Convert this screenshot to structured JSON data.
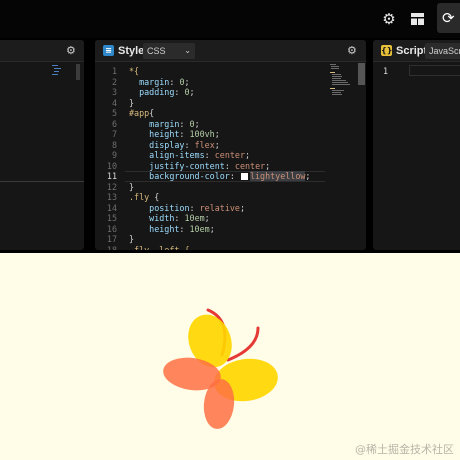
{
  "toolbar": {
    "icons": [
      "gear-icon",
      "layout-icon",
      "run-icon"
    ]
  },
  "css_panel": {
    "title": "Style",
    "badge": "≡",
    "lang": "CSS",
    "lines": [
      [
        [
          "*{",
          "t-sel"
        ]
      ],
      [
        [
          "  margin",
          "t-prop"
        ],
        [
          ": ",
          "t-br"
        ],
        [
          "0",
          "t-num"
        ],
        [
          ";",
          "t-br"
        ]
      ],
      [
        [
          "  padding",
          "t-prop"
        ],
        [
          ": ",
          "t-br"
        ],
        [
          "0",
          "t-num"
        ],
        [
          ";",
          "t-br"
        ]
      ],
      [
        [
          "}",
          "t-br"
        ]
      ],
      [
        [
          "#app",
          "t-sel"
        ],
        [
          "{",
          "t-br"
        ]
      ],
      [
        [
          "    margin",
          "t-prop"
        ],
        [
          ": ",
          "t-br"
        ],
        [
          "0",
          "t-num"
        ],
        [
          ";",
          "t-br"
        ]
      ],
      [
        [
          "    height",
          "t-prop"
        ],
        [
          ": ",
          "t-br"
        ],
        [
          "100vh",
          "t-num"
        ],
        [
          ";",
          "t-br"
        ]
      ],
      [
        [
          "    display",
          "t-prop"
        ],
        [
          ": ",
          "t-br"
        ],
        [
          "flex",
          "t-val"
        ],
        [
          ";",
          "t-br"
        ]
      ],
      [
        [
          "    align-items",
          "t-prop"
        ],
        [
          ": ",
          "t-br"
        ],
        [
          "center",
          "t-val"
        ],
        [
          ";",
          "t-br"
        ]
      ],
      [
        [
          "    justify-content",
          "t-prop"
        ],
        [
          ": ",
          "t-br"
        ],
        [
          "center",
          "t-val"
        ],
        [
          ";",
          "t-br"
        ]
      ],
      [
        [
          "    background-color",
          "t-prop"
        ],
        [
          ": ",
          "t-br"
        ],
        [
          "__SWATCH__",
          ""
        ],
        [
          "lightyellow",
          "t-val hl"
        ],
        [
          ";",
          "t-br"
        ]
      ],
      [
        [
          "}",
          "t-br"
        ]
      ],
      [
        [
          ".fly ",
          "t-sel"
        ],
        [
          "{",
          "t-br"
        ]
      ],
      [
        [
          "    position",
          "t-prop"
        ],
        [
          ": ",
          "t-br"
        ],
        [
          "relative",
          "t-val"
        ],
        [
          ";",
          "t-br"
        ]
      ],
      [
        [
          "    width",
          "t-prop"
        ],
        [
          ": ",
          "t-br"
        ],
        [
          "10em",
          "t-num"
        ],
        [
          ";",
          "t-br"
        ]
      ],
      [
        [
          "    height",
          "t-prop"
        ],
        [
          ": ",
          "t-br"
        ],
        [
          "10em",
          "t-num"
        ],
        [
          ";",
          "t-br"
        ]
      ],
      [
        [
          "}",
          "t-br"
        ]
      ],
      [
        [
          ".fly .left {",
          "t-sel"
        ]
      ]
    ],
    "active_line": 11
  },
  "js_panel": {
    "title": "Script",
    "badge": "{}",
    "lang": "JavaScript",
    "line": "1"
  },
  "preview": {
    "background": "#fffde7",
    "watermark": "@稀土掘金技术社区",
    "wing_colors": [
      "#ffd600",
      "#ff7043",
      "#e53935"
    ]
  }
}
